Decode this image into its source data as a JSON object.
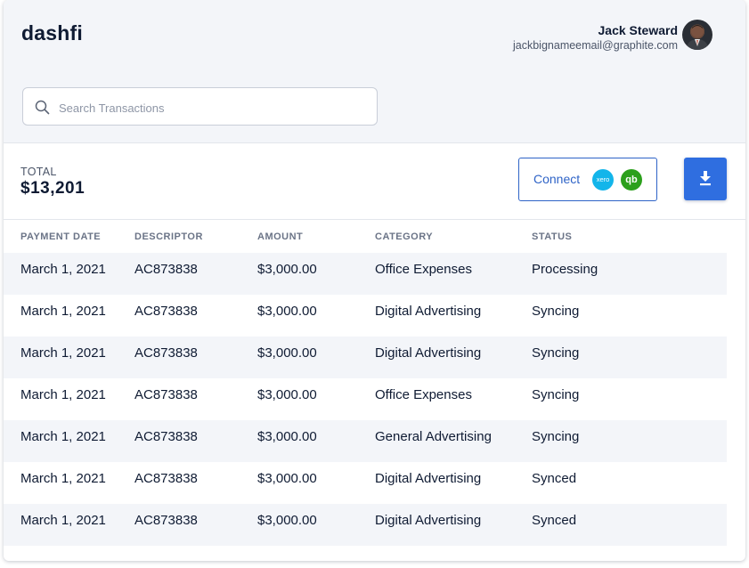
{
  "brand": "dashfi",
  "user": {
    "name": "Jack Steward",
    "email": "jackbignameemail@graphite.com",
    "avatar_icon": "avatar"
  },
  "search": {
    "placeholder": "Search Transactions",
    "value": "",
    "icon": "search-icon"
  },
  "summary": {
    "total_label": "TOTAL",
    "total_value": "$13,201",
    "connect_label": "Connect",
    "xero_label": "xero",
    "qb_label": "qb",
    "download_icon": "download-icon"
  },
  "table": {
    "headers": [
      "PAYMENT DATE",
      "DESCRIPTOR",
      "AMOUNT",
      "CATEGORY",
      "STATUS"
    ],
    "rows": [
      {
        "date": "March 1, 2021",
        "descriptor": "AC873838",
        "amount": "$3,000.00",
        "category": "Office Expenses",
        "status": "Processing"
      },
      {
        "date": "March 1, 2021",
        "descriptor": "AC873838",
        "amount": "$3,000.00",
        "category": "Digital Advertising",
        "status": "Syncing"
      },
      {
        "date": "March 1, 2021",
        "descriptor": "AC873838",
        "amount": "$3,000.00",
        "category": "Digital Advertising",
        "status": "Syncing"
      },
      {
        "date": "March 1, 2021",
        "descriptor": "AC873838",
        "amount": "$3,000.00",
        "category": "Office Expenses",
        "status": "Syncing"
      },
      {
        "date": "March 1, 2021",
        "descriptor": "AC873838",
        "amount": "$3,000.00",
        "category": "General Advertising",
        "status": "Syncing"
      },
      {
        "date": "March 1, 2021",
        "descriptor": "AC873838",
        "amount": "$3,000.00",
        "category": "Digital Advertising",
        "status": "Synced"
      },
      {
        "date": "March 1, 2021",
        "descriptor": "AC873838",
        "amount": "$3,000.00",
        "category": "Digital Advertising",
        "status": "Synced"
      }
    ]
  },
  "colors": {
    "accent": "#2f6ee0",
    "xero": "#13b5ea",
    "quickbooks": "#2ca01c",
    "text": "#0f1b33"
  }
}
